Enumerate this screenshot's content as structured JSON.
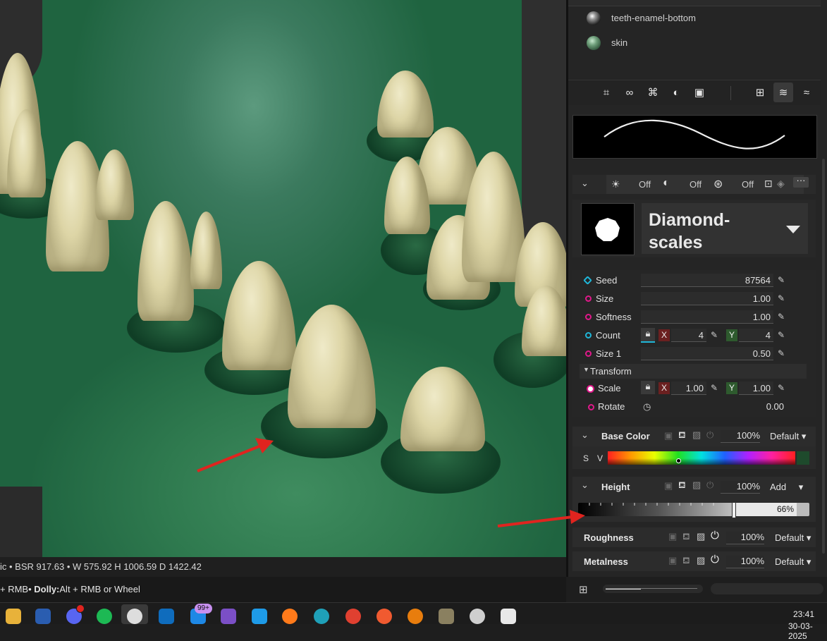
{
  "viewport": {
    "status_text": "ic • BSR 917.63 • W 575.92 H 1006.59 D 1422.42",
    "hint_prefix": "+ RMB•",
    "hint_bold": " Dolly:",
    "hint_rest": "Alt + RMB or Wheel"
  },
  "materials": [
    {
      "name": "teeth-enamel-bottom",
      "color": "#bdbdbd"
    },
    {
      "name": "skin",
      "color": "#6f9f7b"
    }
  ],
  "toolbar_icons": [
    "crop-icon",
    "link-icon",
    "grid-icon",
    "contrast-icon",
    "book-icon",
    "add-layer-icon",
    "layers-icon",
    "layers-alt-icon"
  ],
  "filter_row": {
    "off1": "Off",
    "off2": "Off",
    "off3": "Off"
  },
  "pattern": {
    "name_line1": "Diamond-",
    "name_line2": "scales"
  },
  "params": {
    "seed": {
      "label": "Seed",
      "value": "87564"
    },
    "size": {
      "label": "Size",
      "value": "1.00"
    },
    "softness": {
      "label": "Softness",
      "value": "1.00"
    },
    "count": {
      "label": "Count",
      "x": "4",
      "y": "4"
    },
    "size1": {
      "label": "Size 1",
      "value": "0.50"
    },
    "transform": {
      "label": "Transform"
    },
    "scale": {
      "label": "Scale",
      "x": "1.00",
      "y": "1.00"
    },
    "rotate": {
      "label": "Rotate",
      "value": "0.00"
    }
  },
  "xy_labels": {
    "x": "X",
    "y": "Y"
  },
  "channels": {
    "base_color": {
      "title": "Base Color",
      "opacity": "100%",
      "blend": "Default",
      "s": "S",
      "v": "V",
      "swatch": "#1e4a2c"
    },
    "height": {
      "title": "Height",
      "opacity": "100%",
      "blend": "Add",
      "level_text": "66%",
      "level": 0.66
    },
    "roughness": {
      "title": "Roughness",
      "opacity": "100%",
      "blend": "Default"
    },
    "metalness": {
      "title": "Metalness",
      "opacity": "100%",
      "blend": "Default"
    }
  },
  "taskbar": {
    "badge": "99+",
    "time": "23:41",
    "date": "30-03-2025"
  },
  "colors": {
    "arrow": "#e0241f",
    "accent_pink": "#e0188a",
    "accent_cyan": "#1fb6d8"
  }
}
